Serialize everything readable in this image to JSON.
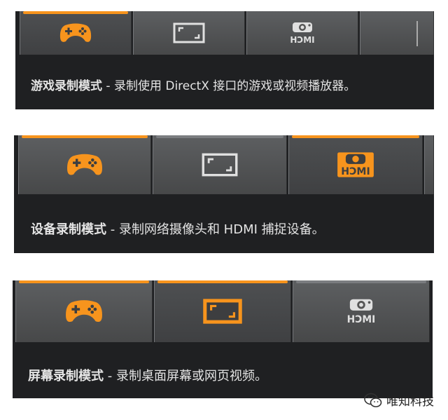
{
  "panels": [
    {
      "mode_label": "游戏录制模式",
      "separator": " - ",
      "description": "录制使用 DirectX 接口的游戏或视频播放器。",
      "active_tab": "game"
    },
    {
      "mode_label": "设备录制模式",
      "separator": " - ",
      "description": "录制网络摄像头和 HDMI 捕捉设备。",
      "active_tab": "device"
    },
    {
      "mode_label": "屏幕录制模式",
      "separator": " - ",
      "description": "录制桌面屏幕或网页视频。",
      "active_tab": "screen"
    }
  ],
  "icons": {
    "game": "gamepad-icon",
    "screen": "screen-capture-icon",
    "device": "hdmi-webcam-icon",
    "hdmi_text": "HƆMI"
  },
  "colors": {
    "accent": "#f7941d",
    "inactive_icon": "#e0e0e0",
    "panel_bg": "#1f2022"
  },
  "watermark": {
    "text": "唯知科技",
    "icon": "wechat-icon"
  }
}
